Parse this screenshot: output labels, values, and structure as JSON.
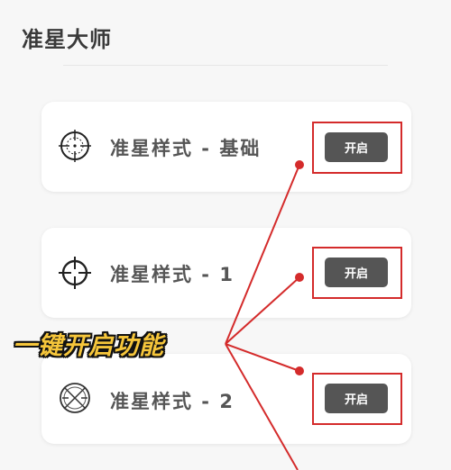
{
  "page": {
    "title": "准星大师"
  },
  "items": [
    {
      "label": "准星样式 - 基础",
      "icon": "crosshair-basic-icon",
      "button_label": "开启"
    },
    {
      "label": "准星样式 - 1",
      "icon": "crosshair-style1-icon",
      "button_label": "开启"
    },
    {
      "label": "准星样式 - 2",
      "icon": "crosshair-style2-icon",
      "button_label": "开启"
    }
  ],
  "annotation": {
    "callout": "一键开启功能"
  },
  "colors": {
    "highlight": "#d42b2b",
    "button_bg": "#555555",
    "callout_text": "#f6c63b"
  }
}
